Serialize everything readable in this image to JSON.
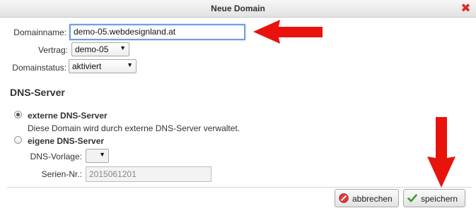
{
  "window": {
    "title": "Neue Domain"
  },
  "form": {
    "domainname_label": "Domainname:",
    "domainname_value": "demo-05.webdesignland.at",
    "vertrag_label": "Vertrag:",
    "vertrag_value": "demo-05",
    "domainstatus_label": "Domainstatus:",
    "domainstatus_value": "aktiviert"
  },
  "dns": {
    "section_title": "DNS-Server",
    "external_label": "externe DNS-Server",
    "external_desc": "Diese Domain wird durch externe DNS-Server verwaltet.",
    "external_selected": true,
    "own_label": "eigene DNS-Server",
    "own_selected": false,
    "vorlage_label": "DNS-Vorlage:",
    "vorlage_value": "",
    "serial_label": "Serien-Nr.:",
    "serial_value": "2015061201"
  },
  "buttons": {
    "cancel_label": "abbrechen",
    "save_label": "speichern"
  },
  "colors": {
    "annotation_arrow": "#e8130d",
    "close_icon": "#d92b2b",
    "focus_border": "#6e9ee0"
  },
  "icons": {
    "close": "close-icon",
    "cancel": "cancel-icon",
    "save": "checkmark-icon",
    "radio": "radio-icon",
    "dropdown": "chevron-down-icon",
    "annotation": "arrow-icon"
  }
}
